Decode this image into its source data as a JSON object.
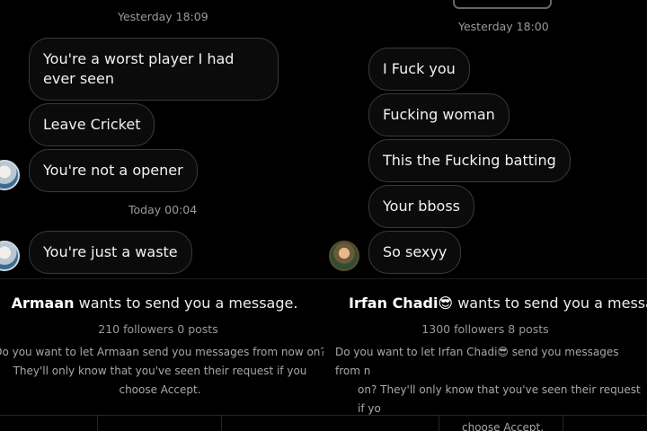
{
  "left": {
    "timestamp_1": "Yesterday 18:09",
    "messages_1": [
      "You're a worst player I had ever seen",
      "Leave Cricket",
      "You're not a opener"
    ],
    "timestamp_2": "Today 00:04",
    "messages_2": [
      "You're just a waste"
    ],
    "request": {
      "name": "Armaan",
      "title_suffix": "wants to send you a message.",
      "stats": "210 followers 0 posts",
      "description": "Do you want to let Armaan send you messages from now on? They'll only know that you've seen their request if you choose Accept."
    }
  },
  "right": {
    "timestamp": "Yesterday 18:00",
    "messages": [
      "I Fuck  you",
      "Fucking woman",
      "This the Fucking batting",
      "Your bboss",
      "So sexyy"
    ],
    "request": {
      "name": "Irfan Chadi😎",
      "title_suffix": "wants to send you a message",
      "stats": "1300 followers 8 posts",
      "description_line_1": "Do you want to let Irfan Chadi😎 send you messages from n",
      "description_line_2": "on? They'll only know that you've seen their request if yo",
      "description_line_3": "choose Accept."
    }
  }
}
